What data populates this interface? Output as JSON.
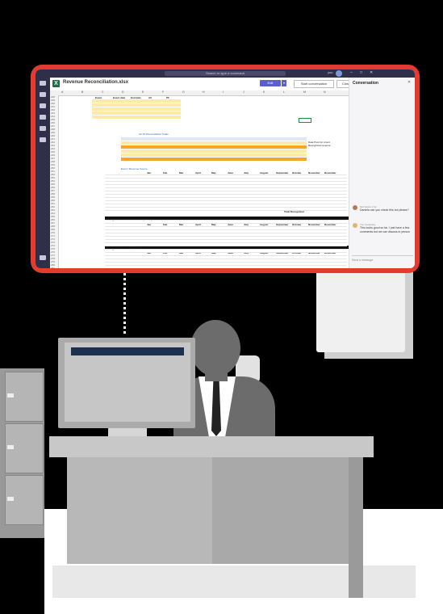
{
  "app": {
    "search_placeholder": "Search or type a command",
    "user_label": "you"
  },
  "file": {
    "title": "Revenue Reconciliation.xlsx",
    "edit_label": "Edit",
    "start_conversation_label": "Start conversation",
    "close_label": "Close"
  },
  "sheet": {
    "column_letters": [
      "A",
      "B",
      "C",
      "D",
      "E",
      "F",
      "G",
      "H",
      "I",
      "J",
      "K",
      "L",
      "M",
      "N"
    ],
    "row_numbers": [
      "228",
      "229",
      "230",
      "231",
      "232",
      "233",
      "234",
      "235",
      "236",
      "237",
      "238",
      "239",
      "240",
      "241",
      "242",
      "243",
      "244",
      "245",
      "246",
      "247",
      "248",
      "249",
      "250",
      "251",
      "252",
      "253",
      "254",
      "255",
      "256",
      "257",
      "258",
      "259",
      "260",
      "261",
      "262",
      "263",
      "264",
      "265",
      "266",
      "267",
      "268",
      "269",
      "270",
      "271",
      "272",
      "273",
      "274",
      "275",
      "276",
      "277",
      "278",
      "279",
      "280",
      "281",
      "282"
    ],
    "top_table_headers": [
      "Event",
      "Event date",
      "End date",
      "AV",
      "PF"
    ],
    "section_title": "AV PF Reconciliation Totals",
    "sub_header": "Event / Revenue Source",
    "mid_headers": [
      "Jan",
      "Feb",
      "Mar",
      "April",
      "May",
      "June",
      "July",
      "August",
      "September",
      "October",
      "November",
      "December"
    ],
    "recognized_label_1": "Recognized as of 03 Purchases (Line 1)",
    "recognized_label_2": "Recognized as of end of December",
    "total_label": "Total Recognized",
    "note": "Data Pivot for Amort Recognized revenue"
  },
  "conversation": {
    "title": "Conversation",
    "messages": [
      {
        "author": "Nat Vance",
        "time": "1:12",
        "text": "Daniela can you check this out please?"
      },
      {
        "author": "You",
        "time": "Yesterday",
        "text": "This looks good so far. I just have a few comments but we can discuss in person"
      }
    ],
    "input_placeholder": "Send a message"
  },
  "colors": {
    "screen_border": "#e53a2e",
    "teams_dark": "#2f2f4a",
    "excel_green": "#1d6f42",
    "accent": "#5b5fc7",
    "highlight_orange": "#f4a62a",
    "highlight_yellow": "#fde9a9"
  }
}
